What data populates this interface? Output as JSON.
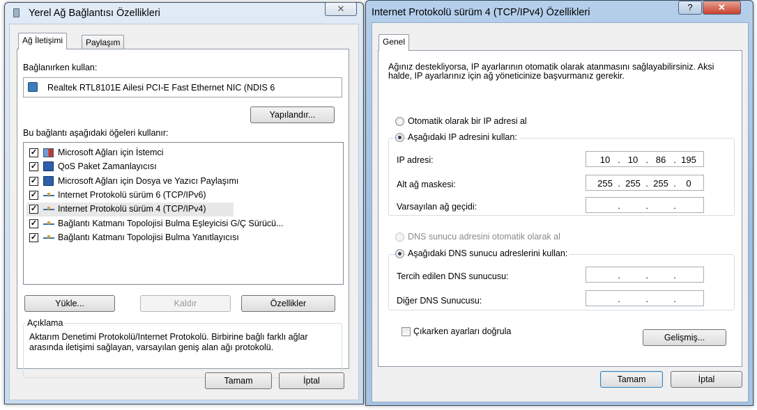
{
  "left_dialog": {
    "title": "Yerel Ağ Bağlantısı Özellikleri",
    "close_label": "✕",
    "tabs": [
      "Ağ İletişimi",
      "Paylaşım"
    ],
    "connect_using_label": "Bağlanırken kullan:",
    "adapter_name": "Realtek RTL8101E Ailesi PCI-E Fast Ethernet NIC (NDIS 6",
    "configure_label": "Yapılandır...",
    "items_label": "Bu bağlantı aşağıdaki öğeleri kullanır:",
    "items": [
      {
        "label": "Microsoft Ağları için İstemci",
        "checked": true,
        "icon": "network-client-icon"
      },
      {
        "label": "QoS Paket Zamanlayıcısı",
        "checked": true,
        "icon": "computer-icon"
      },
      {
        "label": "Microsoft Ağları için Dosya ve Yazıcı Paylaşımı",
        "checked": true,
        "icon": "computer-icon"
      },
      {
        "label": "Internet Protokolü sürüm 6 (TCP/IPv6)",
        "checked": true,
        "icon": "protocol-icon"
      },
      {
        "label": "Internet Protokolü sürüm 4 (TCP/IPv4)",
        "checked": true,
        "icon": "protocol-icon"
      },
      {
        "label": "Bağlantı Katmanı Topolojisi Bulma Eşleyicisi G/Ç Sürücü...",
        "checked": true,
        "icon": "protocol-icon"
      },
      {
        "label": "Bağlantı Katmanı Topolojisi Bulma Yanıtlayıcısı",
        "checked": true,
        "icon": "protocol-icon"
      }
    ],
    "install_label": "Yükle...",
    "uninstall_label": "Kaldır",
    "properties_label": "Özellikler",
    "description_title": "Açıklama",
    "description_text": "Aktarım Denetimi Protokolü/Internet Protokolü. Birbirine bağlı farklı ağlar arasında iletişimi sağlayan, varsayılan geniş alan ağı protokolü.",
    "ok_label": "Tamam",
    "cancel_label": "İptal"
  },
  "right_dialog": {
    "title": "Internet Protokolü sürüm 4 (TCP/IPv4) Özellikleri",
    "help_label": "?",
    "close_label": "✕",
    "tab": "Genel",
    "intro_text": "Ağınız destekliyorsa, IP ayarlarının otomatik olarak atanmasını sağlayabilirsiniz. Aksi halde, IP ayarlarınız için ağ yöneticinize başvurmanız gerekir.",
    "auto_ip_label": "Otomatik olarak bir IP adresi al",
    "manual_ip_label": "Aşağıdaki IP adresini kullan:",
    "ip_label": "IP adresi:",
    "ip_value": [
      "10",
      "10",
      "86",
      "195"
    ],
    "mask_label": "Alt ağ maskesi:",
    "mask_value": [
      "255",
      "255",
      "255",
      "0"
    ],
    "gateway_label": "Varsayılan ağ geçidi:",
    "gateway_value": [
      "",
      "",
      "",
      ""
    ],
    "auto_dns_label": "DNS sunucu adresini otomatik olarak al",
    "manual_dns_label": "Aşağıdaki DNS sunucu adreslerini kullan:",
    "preferred_dns_label": "Tercih edilen DNS sunucusu:",
    "preferred_dns_value": [
      "",
      "",
      "",
      ""
    ],
    "alternate_dns_label": "Diğer DNS Sunucusu:",
    "alternate_dns_value": [
      "",
      "",
      "",
      ""
    ],
    "validate_label": "Çıkarken ayarları doğrula",
    "advanced_label": "Gelişmiş...",
    "ok_label": "Tamam",
    "cancel_label": "İptal"
  }
}
